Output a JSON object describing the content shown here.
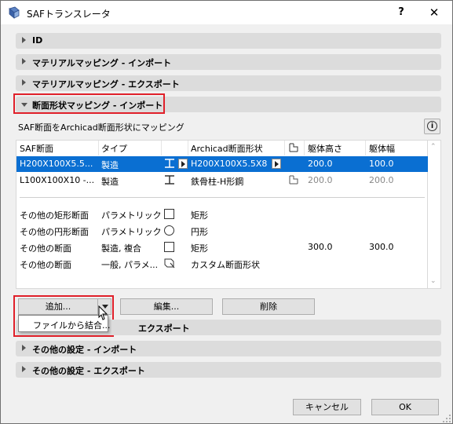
{
  "window": {
    "title": "SAFトランスレータ",
    "help": "?",
    "close": "✕"
  },
  "sections": [
    {
      "label": "ID",
      "expanded": false
    },
    {
      "label": "マテリアルマッピング - インポート",
      "expanded": false
    },
    {
      "label": "マテリアルマッピング - エクスポート",
      "expanded": false
    },
    {
      "label": "断面形状マッピング - インポート",
      "expanded": true
    }
  ],
  "mapping": {
    "description": "SAF断面をArchicad断面形状にマッピング",
    "info_icon": "i",
    "headers": {
      "saf": "SAF断面",
      "type": "タイプ",
      "archicad": "Archicad断面形状",
      "height": "躯体高さ",
      "width": "躯体幅"
    },
    "rows": [
      {
        "saf": "H200X100X5.5...",
        "type": "製造",
        "archicad": "H200X100X5.5X8",
        "height": "200.0",
        "width": "100.0",
        "selected": true
      },
      {
        "saf": "L100X100X10 -...",
        "type": "製造",
        "archicad": "鉄骨柱-H形鋼",
        "height": "200.0",
        "width": "200.0",
        "selected": false
      }
    ],
    "defaults": [
      {
        "saf": "その他の矩形断面",
        "type": "パラメトリック",
        "archicad": "矩形",
        "height": "",
        "width": "",
        "control": "checkbox"
      },
      {
        "saf": "その他の円形断面",
        "type": "パラメトリック",
        "archicad": "円形",
        "height": "",
        "width": "",
        "control": "radio"
      },
      {
        "saf": "その他の断面",
        "type": "製造, 複合",
        "archicad": "矩形",
        "height": "300.0",
        "width": "300.0",
        "control": "checkbox"
      },
      {
        "saf": "その他の断面",
        "type": "一般, パラメ...",
        "archicad": "カスタム断面形状",
        "height": "",
        "width": "",
        "control": "custom"
      }
    ]
  },
  "buttons": {
    "add": "追加...",
    "edit": "編集...",
    "delete": "削除",
    "cancel": "キャンセル",
    "ok": "OK"
  },
  "dropdown": {
    "item": "ファイルから結合..."
  },
  "lower_sections": [
    {
      "label": "断面形状マッピング - エクスポート",
      "visible_label": "エクスポート"
    },
    {
      "label": "その他の設定 - インポート"
    },
    {
      "label": "その他の設定 - エクスポート"
    }
  ],
  "colors": {
    "selection": "#0a6fd2",
    "highlight": "#e0202a"
  }
}
